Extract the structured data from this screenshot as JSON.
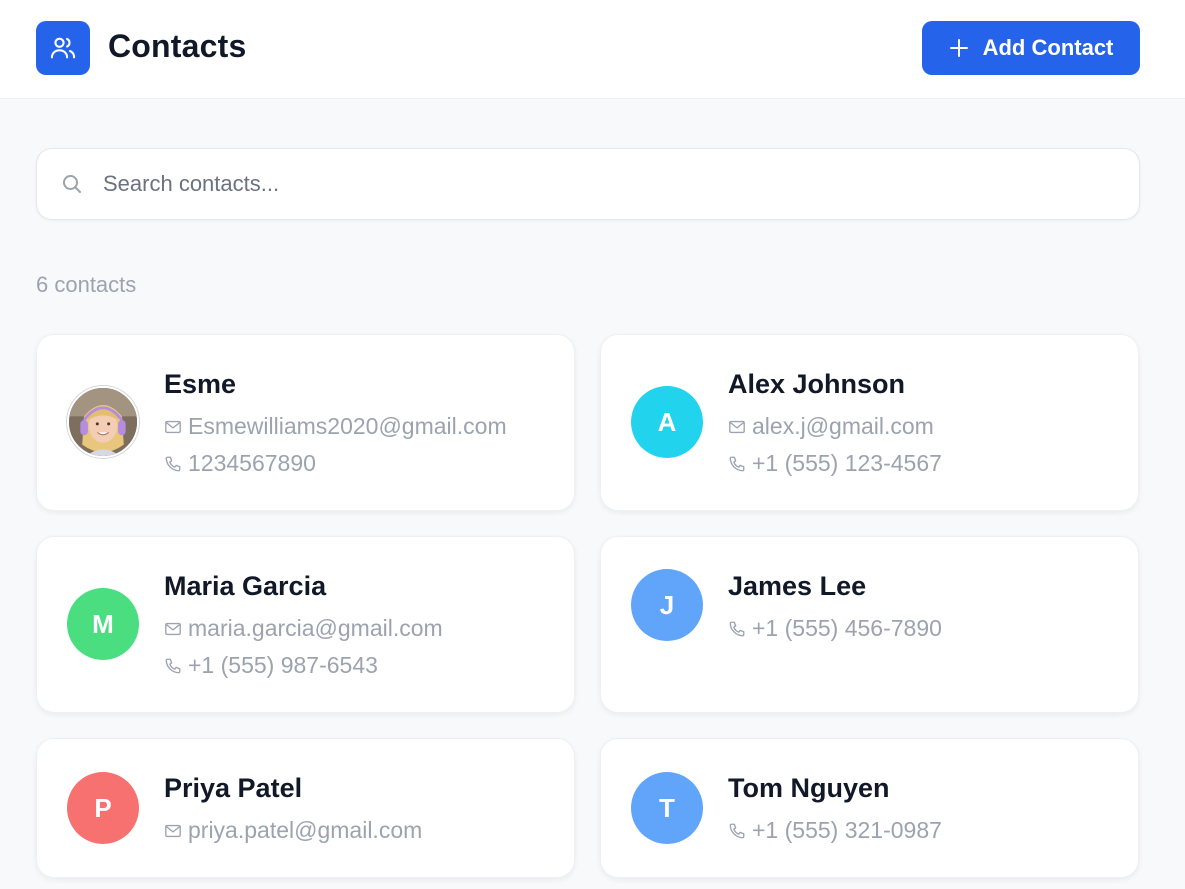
{
  "header": {
    "title": "Contacts",
    "add_button_label": "Add Contact",
    "app_icon": "users-icon",
    "accent_color": "#2563eb"
  },
  "search": {
    "placeholder": "Search contacts...",
    "value": ""
  },
  "contact_count": "6 contacts",
  "contacts": [
    {
      "name": "Esme",
      "email": "Esmewilliams2020@gmail.com",
      "phone": "1234567890",
      "avatar": "photo"
    },
    {
      "name": "Alex Johnson",
      "email": "alex.j@gmail.com",
      "phone": "+1 (555) 123-4567",
      "avatar": "A",
      "color": "#22d3ee"
    },
    {
      "name": "Maria Garcia",
      "email": "maria.garcia@gmail.com",
      "phone": "+1 (555) 987-6543",
      "avatar": "M",
      "color": "#4ade80"
    },
    {
      "name": "James Lee",
      "email": "",
      "phone": "+1 (555) 456-7890",
      "avatar": "J",
      "color": "#60a5fa"
    },
    {
      "name": "Priya Patel",
      "email": "priya.patel@gmail.com",
      "phone": "",
      "avatar": "P",
      "color": "#f87171"
    },
    {
      "name": "Tom Nguyen",
      "email": "",
      "phone": "+1 (555) 321-0987",
      "avatar": "T",
      "color": "#60a5fa"
    }
  ]
}
